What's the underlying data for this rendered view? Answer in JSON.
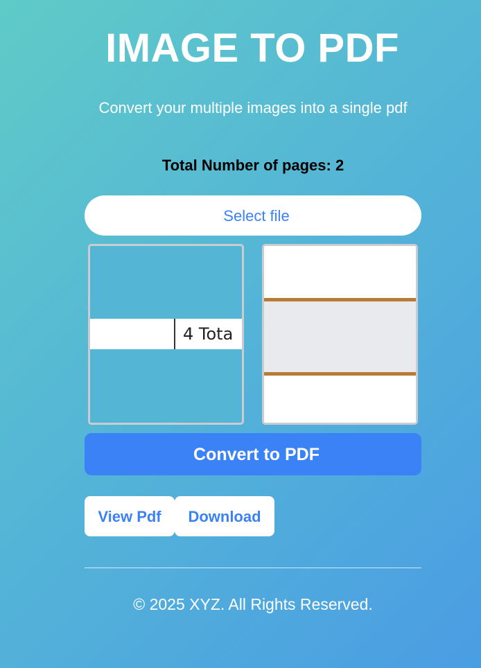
{
  "header": {
    "title": "IMAGE TO PDF",
    "subtitle": "Convert your multiple images into a single pdf"
  },
  "status": {
    "page_count_text": "Total Number of pages: 2"
  },
  "actions": {
    "select_file_label": "Select file",
    "convert_label": "Convert to PDF",
    "view_pdf_label": "View Pdf",
    "download_label": "Download"
  },
  "previews": {
    "image_1_text": "4  Tota"
  },
  "footer": {
    "copyright": "© 2025 XYZ. All Rights Reserved."
  },
  "colors": {
    "accent": "#3b82f6",
    "gradient_start": "#5fcbc7",
    "gradient_end": "#4a9de3",
    "thumb_border": "#c9cdd2",
    "preview_rule": "#b77b35"
  }
}
